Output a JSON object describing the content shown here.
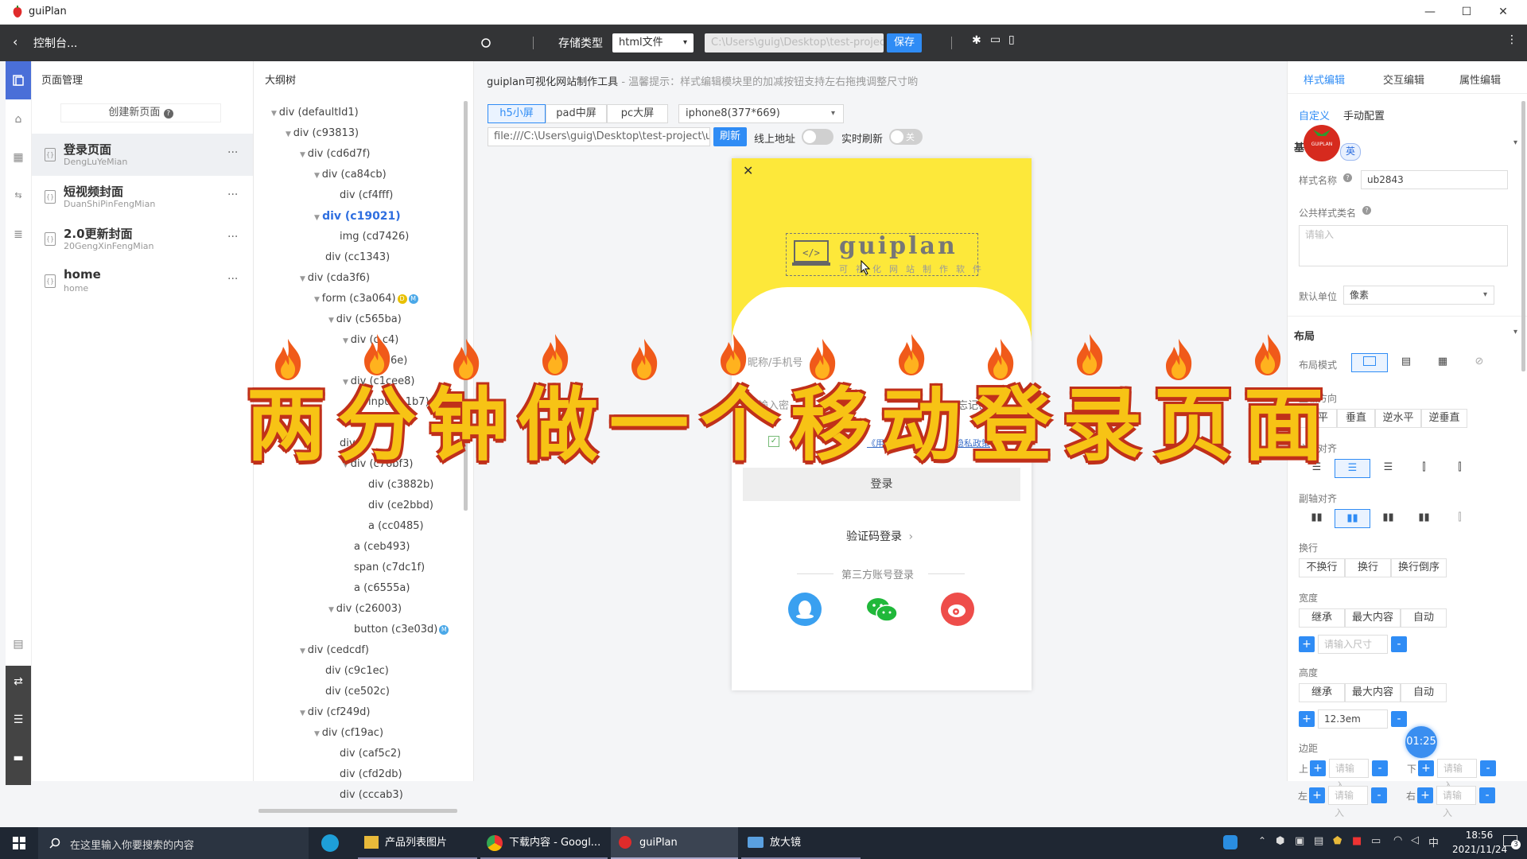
{
  "window": {
    "title": "guiPlan",
    "minimize": "—",
    "maximize": "☐",
    "close": "✕"
  },
  "toolbar": {
    "back_label": "控制台...",
    "storage_type_label": "存储类型",
    "storage_type_value": "html文件",
    "path_value": "C:\\Users\\guig\\Desktop\\test-project",
    "save_label": "保存",
    "more": "⋮"
  },
  "pages_panel": {
    "title": "页面管理",
    "create_label": "创建新页面",
    "items": [
      {
        "name": "登录页面",
        "sub": "DengLuYeMian"
      },
      {
        "name": "短视频封面",
        "sub": "DuanShiPinFengMian"
      },
      {
        "name": "2.0更新封面",
        "sub": "20GengXinFengMian"
      },
      {
        "name": "home",
        "sub": "home"
      }
    ],
    "more": "..."
  },
  "tree_panel": {
    "title": "大纲树",
    "nodes": [
      {
        "label": "div (defaultId1)"
      },
      {
        "label": "div (c93813)"
      },
      {
        "label": "div (cd6d7f)"
      },
      {
        "label": "div (ca84cb)"
      },
      {
        "label": "div (cf4fff)"
      },
      {
        "label": "div (c19021)"
      },
      {
        "label": "img (cd7426)"
      },
      {
        "label": "div (cc1343)"
      },
      {
        "label": "div (cda3f6)"
      },
      {
        "label": "form (c3a064)"
      },
      {
        "label": "div (c565ba)"
      },
      {
        "label": "div (c    c4)"
      },
      {
        "label": "cfe56e)"
      },
      {
        "label": "div (c1cee8)"
      },
      {
        "label": "input (    1b7)"
      },
      {
        "label": ""
      },
      {
        "label": "div (c"
      },
      {
        "label": "div (c76bf3)"
      },
      {
        "label": "div (c3882b)"
      },
      {
        "label": "div (ce2bbd)"
      },
      {
        "label": "a (cc0485)"
      },
      {
        "label": "a (ceb493)"
      },
      {
        "label": "span (c7dc1f)"
      },
      {
        "label": "a (c6555a)"
      },
      {
        "label": "div (c26003)"
      },
      {
        "label": "button (c3e03d)"
      },
      {
        "label": "div (cedcdf)"
      },
      {
        "label": "div (c9c1ec)"
      },
      {
        "label": "div (ce502c)"
      },
      {
        "label": "div (cf249d)"
      },
      {
        "label": "div (cf19ac)"
      },
      {
        "label": "div (caf5c2)"
      },
      {
        "label": "div (cfd2db)"
      },
      {
        "label": "div (cccab3)"
      }
    ],
    "badge_d": "D",
    "badge_m": "M"
  },
  "canvas": {
    "hint_title": "guiplan可视化网站制作工具",
    "hint_text": " - 温馨提示：样式编辑模块里的加减按钮支持左右拖拽调整尺寸哟",
    "screens": [
      "h5小屏",
      "pad中屏",
      "pc大屏"
    ],
    "device_value": "iphone8(377*669)",
    "url_value": "file:///C:\\Users\\guig\\Desktop\\test-project\\us",
    "refresh_label": "刷新",
    "online_label": "线上地址",
    "live_refresh_label": "实时刷新",
    "toggle_off": "关"
  },
  "phone": {
    "close": "✕",
    "logo_text": "guiplan",
    "logo_sub": "可视化网站制作软件",
    "user_placeholder": "昵称/手机号",
    "pwd_placeholder": "请输入密",
    "forgot": "忘记密",
    "agree_link1": "《用户",
    "agree_link2": "《隐私政策",
    "login_button": "登录",
    "sms_login": "验证码登录",
    "third_party": "第三方账号登录"
  },
  "right_panel": {
    "tabs": [
      "样式编辑",
      "交互编辑",
      "属性编辑"
    ],
    "subtabs": [
      "自定义",
      "手动配置"
    ],
    "basic_label": "基",
    "lang_badge": "英",
    "style_name_label": "样式名称",
    "style_name_value": "ub2843",
    "common_class_label": "公共样式类名",
    "common_class_placeholder": "请输入",
    "unit_label": "默认单位",
    "unit_value": "像素",
    "layout_section": "布局",
    "layout_mode_label": "布局模式",
    "main_axis_label": "主轴方向",
    "main_axis_options": [
      "水平",
      "垂直",
      "逆水平",
      "逆垂直"
    ],
    "main_align_label": "主轴对齐",
    "cross_align_label": "副轴对齐",
    "wrap_label": "换行",
    "wrap_options": [
      "不换行",
      "换行",
      "换行倒序"
    ],
    "width_label": "宽度",
    "width_options": [
      "继承",
      "最大内容",
      "自动"
    ],
    "width_placeholder": "请输入尺寸",
    "height_label": "高度",
    "height_options": [
      "继承",
      "最大内容",
      "自动"
    ],
    "height_value": "12.3em",
    "margin_label": "边距",
    "margin_top": "上",
    "margin_bottom": "下",
    "margin_left": "左",
    "margin_right": "右",
    "input_placeholder": "请输入",
    "timer": "01:25"
  },
  "overlay": {
    "caption": "两分钟做一个移动登录页面",
    "logo_small": "GUIPLAN"
  },
  "taskbar": {
    "search_placeholder": "在这里输入你要搜索的内容",
    "apps": [
      "产品列表图片",
      "下载内容 - Googl...",
      "guiPlan",
      "放大镜"
    ],
    "time": "18:56",
    "date": "2021/11/24",
    "notif_count": "3"
  },
  "colors": {
    "accent": "#2f8cf5",
    "toolbar_bg": "#333436",
    "phone_header": "#fde83a",
    "overlay_text": "#f7c315",
    "overlay_outline": "#c0301a"
  }
}
